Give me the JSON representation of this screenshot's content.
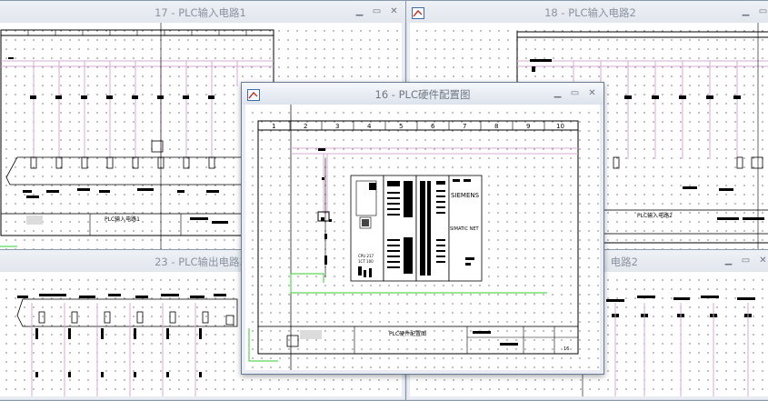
{
  "colors": {
    "workspace": "#aab4c2",
    "wire_pink": "#d8a9d3",
    "wire_green": "#33cc33",
    "ink": "#000000"
  },
  "windows": {
    "input1": {
      "title": "17 - PLC输入电路1",
      "title_block": "PLC输入电路1",
      "min": "▁",
      "max": "▭",
      "close": "✕"
    },
    "input2": {
      "title": "18 - PLC输入电路2",
      "title_block": "PLC输入电路2",
      "min": "▁",
      "max": "▭",
      "close": "✕"
    },
    "output3": {
      "title": "23 - PLC输出电路3",
      "min": "▁",
      "max": "▭",
      "close": "✕"
    },
    "output2": {
      "title": "电路2",
      "min": "▁",
      "max": "▭",
      "close": "✕"
    },
    "hardware": {
      "title": "16 - PLC硬件配置图",
      "title_block": "PLC硬件配置图",
      "min": "▁",
      "max": "▭",
      "close": "✕",
      "ruler": [
        "1",
        "2",
        "3",
        "4",
        "5",
        "6",
        "7",
        "8",
        "9",
        "10"
      ],
      "brand": "SIEMENS",
      "module_label": "SIMATIC NET",
      "cpu_text1": "CPU 217",
      "cpu_text2": "1CT 100",
      "sheet_no": "16"
    }
  }
}
